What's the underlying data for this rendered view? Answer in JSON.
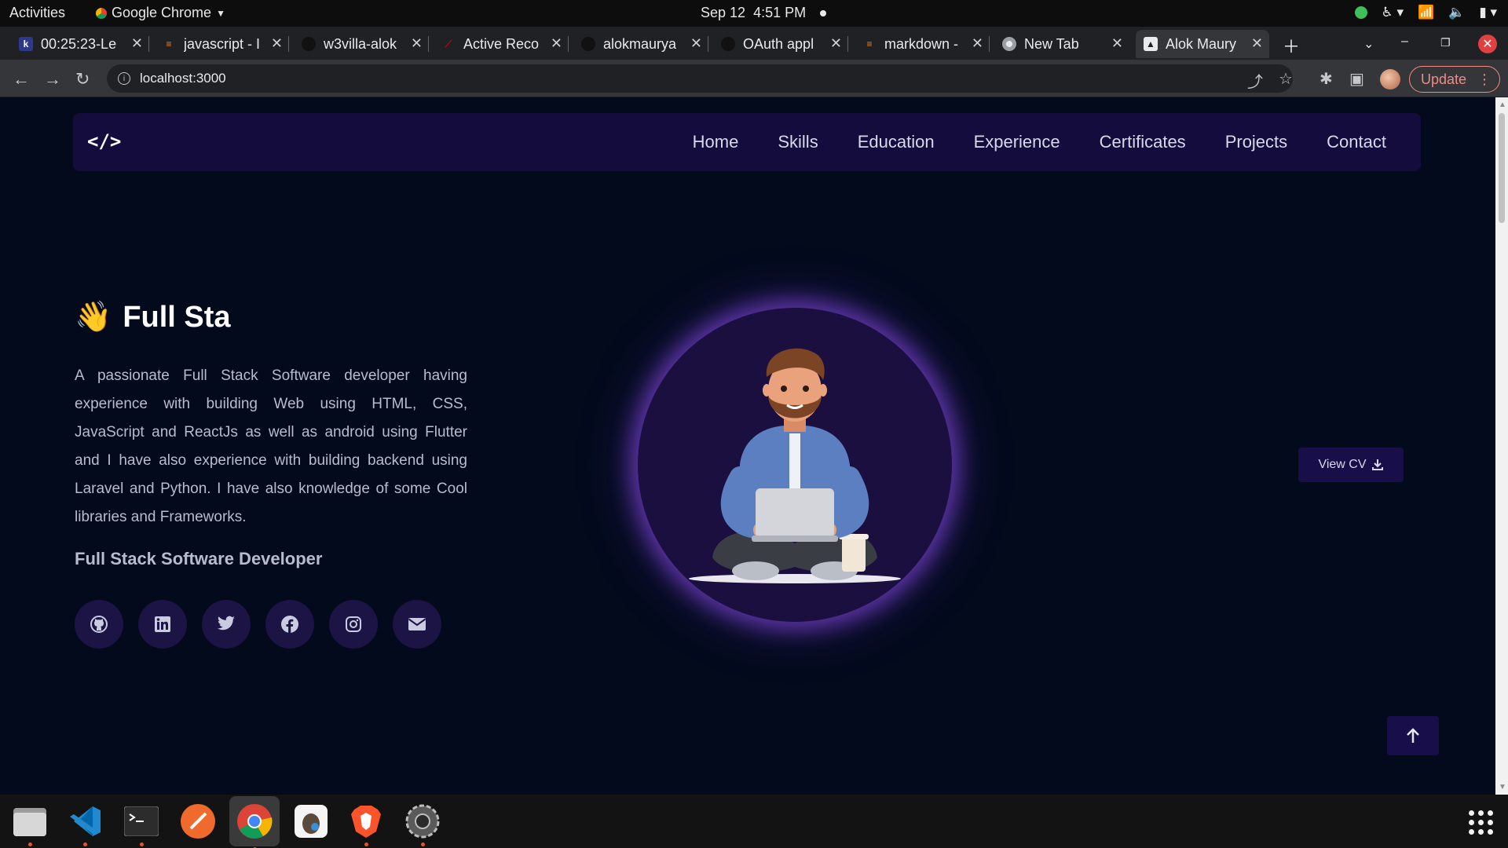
{
  "system_bar": {
    "activities": "Activities",
    "app_name": "Google Chrome",
    "date": "Sep 12",
    "time": "4:51 PM"
  },
  "browser": {
    "tabs": [
      {
        "title": "00:25:23-Le",
        "icon": "k-icon"
      },
      {
        "title": "javascript - I",
        "icon": "stackoverflow-icon"
      },
      {
        "title": "w3villa-alok",
        "icon": "github-icon"
      },
      {
        "title": "Active Reco",
        "icon": "rails-icon"
      },
      {
        "title": "alokmaurya",
        "icon": "github-icon"
      },
      {
        "title": "OAuth appl",
        "icon": "github-icon"
      },
      {
        "title": "markdown -",
        "icon": "stackoverflow-icon"
      },
      {
        "title": "New Tab",
        "icon": "chrome-icon"
      },
      {
        "title": "Alok Maury",
        "icon": "site-icon"
      }
    ],
    "url": "localhost:3000",
    "update_label": "Update"
  },
  "site": {
    "logo": "</>",
    "nav": [
      "Home",
      "Skills",
      "Education",
      "Experience",
      "Certificates",
      "Projects",
      "Contact"
    ],
    "hero": {
      "emoji": "👋",
      "title": "Full Sta",
      "description": "A passionate Full Stack Software developer having experience with building Web using HTML, CSS, JavaScript and ReactJs as well as android using Flutter and I have also experience with building backend using Laravel and Python. I have also knowledge of some Cool libraries and Frameworks.",
      "subtitle": "Full Stack Software Developer",
      "socials": [
        "github-icon",
        "linkedin-icon",
        "twitter-icon",
        "facebook-icon",
        "instagram-icon",
        "email-icon"
      ]
    },
    "view_cv_label": "View CV"
  },
  "colors": {
    "page_bg": "#030a1c",
    "nav_bg": "#140c3d",
    "accent_glow": "#8048dc",
    "button_bg": "#180f4a"
  },
  "dock": [
    "files-icon",
    "vscode-icon",
    "terminal-icon",
    "postman-icon",
    "chrome-icon",
    "dbeaver-icon",
    "brave-icon",
    "settings-icon"
  ]
}
